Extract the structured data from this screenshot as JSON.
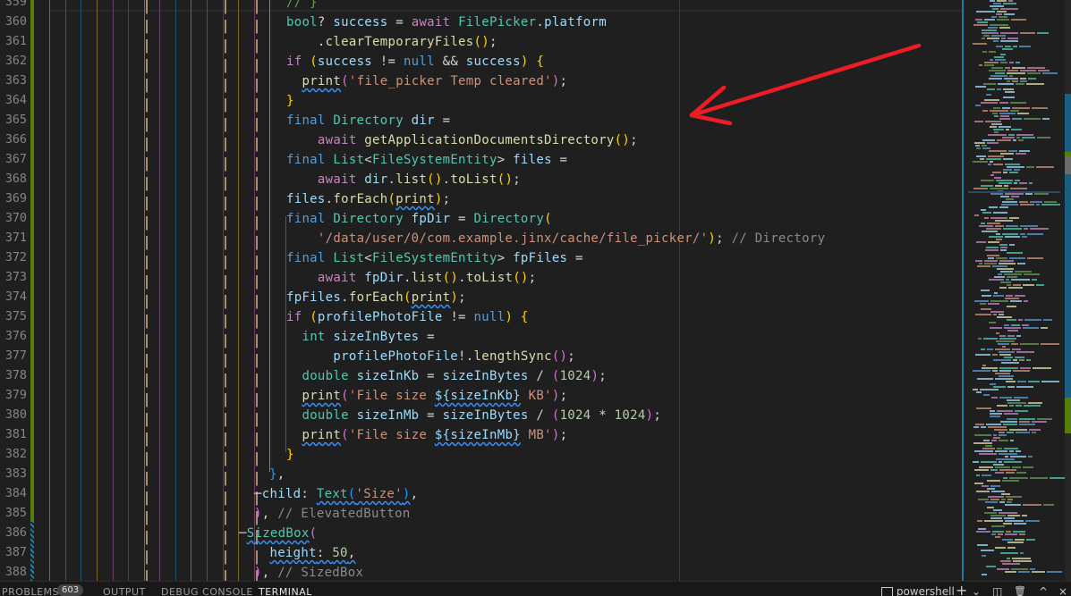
{
  "editor": {
    "line_numbers": [
      "359",
      "360",
      "361",
      "362",
      "363",
      "364",
      "365",
      "366",
      "367",
      "368",
      "369",
      "370",
      "371",
      "372",
      "373",
      "374",
      "375",
      "376",
      "377",
      "378",
      "379",
      "380",
      "381",
      "382",
      "383",
      "384",
      "385",
      "386",
      "387",
      "388"
    ],
    "lines": [
      {
        "tokens": [
          [
            "cm",
            "// }"
          ]
        ]
      },
      {
        "tokens": [
          [
            "kw",
            "bool"
          ],
          [
            "op",
            "? "
          ],
          [
            "var",
            "success"
          ],
          [
            "op",
            " = "
          ],
          [
            "ctrl",
            "await "
          ],
          [
            "ty",
            "FilePicker"
          ],
          [
            "op",
            "."
          ],
          [
            "var",
            "platform"
          ]
        ]
      },
      {
        "tokens": [
          [
            "op",
            "    ."
          ],
          [
            "fn",
            "clearTemporaryFiles"
          ],
          [
            "b1",
            "()"
          ],
          [
            "op",
            ";"
          ]
        ]
      },
      {
        "tokens": [
          [
            "ctrl",
            "if "
          ],
          [
            "b1",
            "("
          ],
          [
            "var",
            "success"
          ],
          [
            "op",
            " != "
          ],
          [
            "nl",
            "null"
          ],
          [
            "op",
            " && "
          ],
          [
            "var",
            "success"
          ],
          [
            "b1",
            ")"
          ],
          [
            "op",
            " "
          ],
          [
            "b1",
            "{"
          ]
        ]
      },
      {
        "tokens": [
          [
            "op",
            "  "
          ],
          [
            "fn sq",
            "print"
          ],
          [
            "b2",
            "("
          ],
          [
            "str",
            "'file_picker Temp cleared'"
          ],
          [
            "b2",
            ")"
          ],
          [
            "op",
            ";"
          ]
        ]
      },
      {
        "tokens": [
          [
            "b1",
            "}"
          ]
        ]
      },
      {
        "tokens": [
          [
            "nl",
            "final "
          ],
          [
            "ty",
            "Directory "
          ],
          [
            "var",
            "dir"
          ],
          [
            "op",
            " ="
          ]
        ]
      },
      {
        "tokens": [
          [
            "op",
            "    "
          ],
          [
            "ctrl",
            "await "
          ],
          [
            "fn",
            "getApplicationDocumentsDirectory"
          ],
          [
            "b1",
            "()"
          ],
          [
            "op",
            ";"
          ]
        ]
      },
      {
        "tokens": [
          [
            "nl",
            "final "
          ],
          [
            "ty",
            "List"
          ],
          [
            "op",
            "<"
          ],
          [
            "ty",
            "FileSystemEntity"
          ],
          [
            "op",
            "> "
          ],
          [
            "var",
            "files"
          ],
          [
            "op",
            " ="
          ]
        ]
      },
      {
        "tokens": [
          [
            "op",
            "    "
          ],
          [
            "ctrl",
            "await "
          ],
          [
            "var",
            "dir"
          ],
          [
            "op",
            "."
          ],
          [
            "fn",
            "list"
          ],
          [
            "b1",
            "()"
          ],
          [
            "op",
            "."
          ],
          [
            "fn",
            "toList"
          ],
          [
            "b1",
            "()"
          ],
          [
            "op",
            ";"
          ]
        ]
      },
      {
        "tokens": [
          [
            "var",
            "files"
          ],
          [
            "op",
            "."
          ],
          [
            "fn",
            "forEach"
          ],
          [
            "b1",
            "("
          ],
          [
            "fn sq",
            "print"
          ],
          [
            "b1",
            ")"
          ],
          [
            "op",
            ";"
          ]
        ]
      },
      {
        "tokens": [
          [
            "nl",
            "final "
          ],
          [
            "ty",
            "Directory "
          ],
          [
            "var",
            "fpDir"
          ],
          [
            "op",
            " = "
          ],
          [
            "ty",
            "Directory"
          ],
          [
            "b1",
            "("
          ]
        ]
      },
      {
        "tokens": [
          [
            "op",
            "    "
          ],
          [
            "str",
            "'/data/user/0/com.example.jinx/cache/file_picker/'"
          ],
          [
            "b1",
            ")"
          ],
          [
            "op",
            "; "
          ],
          [
            "cmg",
            "// Directory"
          ]
        ]
      },
      {
        "tokens": [
          [
            "nl",
            "final "
          ],
          [
            "ty",
            "List"
          ],
          [
            "op",
            "<"
          ],
          [
            "ty",
            "FileSystemEntity"
          ],
          [
            "op",
            "> "
          ],
          [
            "var",
            "fpFiles"
          ],
          [
            "op",
            " ="
          ]
        ]
      },
      {
        "tokens": [
          [
            "op",
            "    "
          ],
          [
            "ctrl",
            "await "
          ],
          [
            "var",
            "fpDir"
          ],
          [
            "op",
            "."
          ],
          [
            "fn",
            "list"
          ],
          [
            "b1",
            "()"
          ],
          [
            "op",
            "."
          ],
          [
            "fn",
            "toList"
          ],
          [
            "b1",
            "()"
          ],
          [
            "op",
            ";"
          ]
        ]
      },
      {
        "tokens": [
          [
            "var",
            "fpFiles"
          ],
          [
            "op",
            "."
          ],
          [
            "fn",
            "forEach"
          ],
          [
            "b1",
            "("
          ],
          [
            "fn sq",
            "print"
          ],
          [
            "b1",
            ")"
          ],
          [
            "op",
            ";"
          ]
        ]
      },
      {
        "tokens": [
          [
            "ctrl",
            "if "
          ],
          [
            "b1",
            "("
          ],
          [
            "var",
            "profilePhotoFile"
          ],
          [
            "op",
            " != "
          ],
          [
            "nl",
            "null"
          ],
          [
            "b1",
            ")"
          ],
          [
            "op",
            " "
          ],
          [
            "b1",
            "{"
          ]
        ]
      },
      {
        "tokens": [
          [
            "op",
            "  "
          ],
          [
            "kw",
            "int "
          ],
          [
            "var",
            "sizeInBytes"
          ],
          [
            "op",
            " ="
          ]
        ]
      },
      {
        "tokens": [
          [
            "op",
            "      "
          ],
          [
            "var",
            "profilePhotoFile"
          ],
          [
            "op",
            "!."
          ],
          [
            "fn",
            "lengthSync"
          ],
          [
            "b2",
            "()"
          ],
          [
            "op",
            ";"
          ]
        ]
      },
      {
        "tokens": [
          [
            "op",
            "  "
          ],
          [
            "kw",
            "double "
          ],
          [
            "var",
            "sizeInKb"
          ],
          [
            "op",
            " = "
          ],
          [
            "var",
            "sizeInBytes"
          ],
          [
            "op",
            " / "
          ],
          [
            "b2",
            "("
          ],
          [
            "num",
            "1024"
          ],
          [
            "b2",
            ")"
          ],
          [
            "op",
            ";"
          ]
        ]
      },
      {
        "tokens": [
          [
            "op",
            "  "
          ],
          [
            "fn sq",
            "print"
          ],
          [
            "b2",
            "("
          ],
          [
            "str",
            "'File size "
          ],
          [
            "var sq",
            "${sizeInKb}"
          ],
          [
            "str",
            " KB'"
          ],
          [
            "b2",
            ")"
          ],
          [
            "op",
            ";"
          ]
        ]
      },
      {
        "tokens": [
          [
            "op",
            "  "
          ],
          [
            "kw",
            "double "
          ],
          [
            "var",
            "sizeInMb"
          ],
          [
            "op",
            " = "
          ],
          [
            "var",
            "sizeInBytes"
          ],
          [
            "op",
            " / "
          ],
          [
            "b2",
            "("
          ],
          [
            "num",
            "1024"
          ],
          [
            "op",
            " * "
          ],
          [
            "num",
            "1024"
          ],
          [
            "b2",
            ")"
          ],
          [
            "op",
            ";"
          ]
        ]
      },
      {
        "tokens": [
          [
            "op",
            "  "
          ],
          [
            "fn sq",
            "print"
          ],
          [
            "b2",
            "("
          ],
          [
            "str",
            "'File size "
          ],
          [
            "var sq",
            "${sizeInMb}"
          ],
          [
            "str",
            " MB'"
          ],
          [
            "b2",
            ")"
          ],
          [
            "op",
            ";"
          ]
        ]
      },
      {
        "tokens": [
          [
            "b1",
            "}"
          ]
        ]
      },
      {
        "tokens": [
          [
            "b3",
            "}"
          ],
          [
            "op",
            ","
          ]
        ]
      },
      {
        "tokens": [
          [
            "op",
            "─"
          ],
          [
            "var",
            "child"
          ],
          [
            "op",
            ": "
          ],
          [
            "ty sq",
            "Text"
          ],
          [
            "b3 sq",
            "("
          ],
          [
            "str sq",
            "'Size'"
          ],
          [
            "b3 sq",
            ")"
          ],
          [
            "op",
            ","
          ]
        ]
      },
      {
        "tokens": [
          [
            "b2",
            ")"
          ],
          [
            "op",
            ", "
          ],
          [
            "cmg",
            "// ElevatedButton"
          ]
        ]
      },
      {
        "tokens": [
          [
            "op",
            "─"
          ],
          [
            "ty sq",
            "SizedBox"
          ],
          [
            "b2",
            "("
          ]
        ]
      },
      {
        "tokens": [
          [
            "op",
            "  "
          ],
          [
            "var sq",
            "height"
          ],
          [
            "op sq",
            ": "
          ],
          [
            "num sq",
            "50"
          ],
          [
            "op sq",
            ","
          ]
        ]
      },
      {
        "tokens": [
          [
            "b2",
            ")"
          ],
          [
            "op",
            ", "
          ],
          [
            "cmg",
            "// SizedBox"
          ]
        ]
      }
    ],
    "line_indents": [
      320,
      320,
      320,
      320,
      320,
      320,
      320,
      320,
      320,
      320,
      320,
      320,
      320,
      320,
      320,
      320,
      320,
      320,
      320,
      320,
      320,
      320,
      320,
      320,
      301,
      284,
      284,
      267,
      284,
      284
    ]
  },
  "panel": {
    "tabs": [
      {
        "label": "PROBLEMS",
        "active": false
      },
      {
        "label": "OUTPUT",
        "active": false
      },
      {
        "label": "DEBUG CONSOLE",
        "active": false
      },
      {
        "label": "TERMINAL",
        "active": true
      }
    ],
    "problems_count": "603",
    "terminal_name": "powershell",
    "actions": {
      "new_terminal": "+",
      "dropdown": "⌄",
      "split": "◫",
      "kill": "🗑",
      "maximize": "^",
      "close": "×"
    }
  },
  "annotation": {
    "arrow_color": "#ee1c25"
  }
}
